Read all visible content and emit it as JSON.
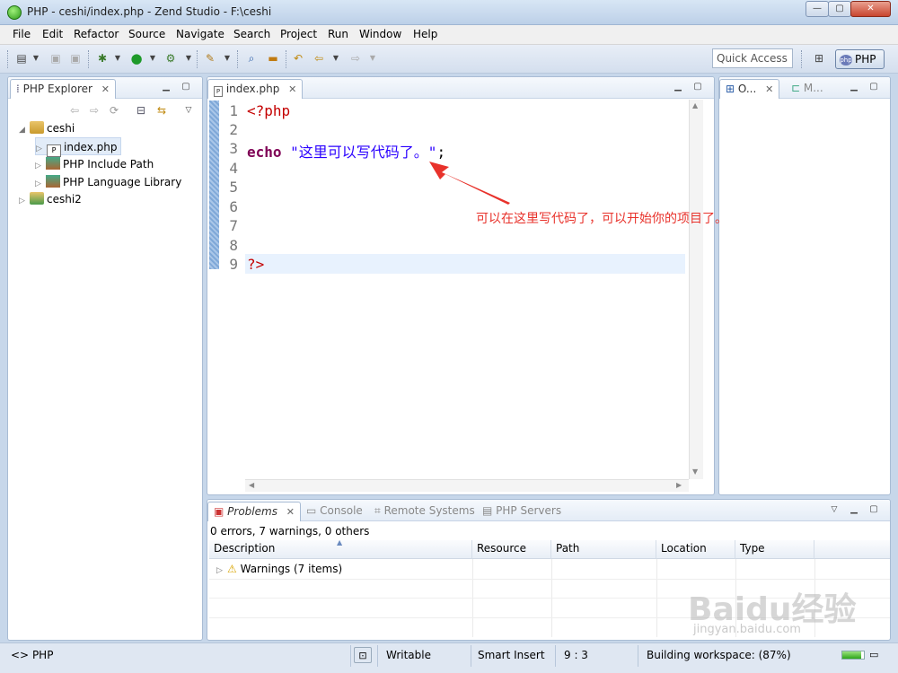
{
  "window": {
    "title": "PHP - ceshi/index.php - Zend Studio - F:\\ceshi"
  },
  "menu": [
    "File",
    "Edit",
    "Refactor",
    "Source",
    "Navigate",
    "Search",
    "Project",
    "Run",
    "Window",
    "Help"
  ],
  "toolbar": {
    "quick_access": "Quick Access",
    "perspective": "PHP"
  },
  "explorer": {
    "tab_label": "PHP Explorer",
    "tree": {
      "project1": "ceshi",
      "file": "index.php",
      "include": "PHP Include Path",
      "library": "PHP Language Library",
      "project2": "ceshi2"
    }
  },
  "editor": {
    "tab_label": "index.php",
    "line_numbers": [
      "1",
      "2",
      "3",
      "4",
      "5",
      "6",
      "7",
      "8",
      "9"
    ],
    "code": {
      "l1": "<?php",
      "l3_kw": "echo",
      "l3_str": "\"这里可以写代码了。\"",
      "l3_end": ";",
      "l9": "?>"
    }
  },
  "outline": {
    "tab_o": "O...",
    "tab_m": "M..."
  },
  "annotation": {
    "text": "可以在这里写代码了，可以开始你的项目了。",
    "color": "#e8322b"
  },
  "bottom": {
    "tabs": [
      "Problems",
      "Console",
      "Remote Systems",
      "PHP Servers"
    ],
    "summary": "0 errors, 7 warnings, 0 others",
    "columns": [
      "Description",
      "Resource",
      "Path",
      "Location",
      "Type"
    ],
    "rows": [
      {
        "description": "Warnings (7 items)"
      }
    ]
  },
  "status": {
    "left": "PHP",
    "writable": "Writable",
    "insert_mode": "Smart Insert",
    "position": "9 : 3",
    "building": "Building workspace: (87%)",
    "progress": 0.87
  },
  "watermark": {
    "brand": "Baidu经验",
    "url": "jingyan.baidu.com"
  }
}
